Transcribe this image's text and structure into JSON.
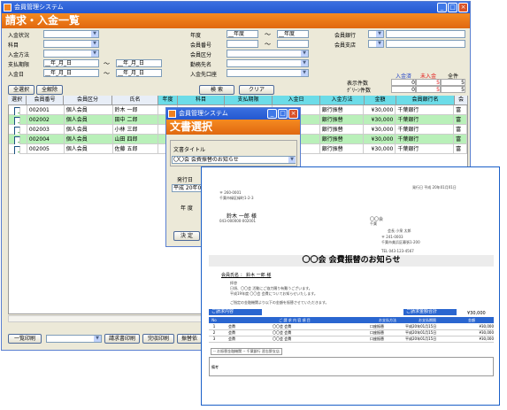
{
  "window": {
    "title": "会員管理システム",
    "header": "請求・入金一覧",
    "buttons": {
      "minimize": "_",
      "maximize": "□",
      "close": "×"
    }
  },
  "filters": {
    "payment_status": {
      "label": "入金状況",
      "value": ""
    },
    "subject": {
      "label": "科目",
      "value": ""
    },
    "payment_method": {
      "label": "入金方法",
      "value": ""
    },
    "due_date": {
      "label": "支払期限",
      "from": "__年_月_日",
      "to": "__年_月_日"
    },
    "payment_date": {
      "label": "入金日",
      "from": "__年_月_日",
      "to": "__年_月_日"
    },
    "year": {
      "label": "年度",
      "from": "__年度",
      "to": "__年度"
    },
    "member_no": {
      "label": "会員番号",
      "from": "",
      "to": ""
    },
    "member_type": {
      "label": "会員区分",
      "value": ""
    },
    "employer": {
      "label": "勤務先名",
      "value": ""
    },
    "payment_counter": {
      "label": "入金先口座",
      "value": ""
    },
    "member_bank": {
      "label": "会員銀行",
      "value": ""
    },
    "member_branch": {
      "label": "会員支店",
      "value": ""
    }
  },
  "actions": {
    "select_all": "全選択",
    "deselect_all": "全解除",
    "search": "検 索",
    "clear": "クリア"
  },
  "counts": {
    "headers": [
      "入金済",
      "未入金",
      "全件"
    ],
    "rows": [
      {
        "label": "表示件数",
        "values": [
          "0",
          "5",
          "5"
        ]
      },
      {
        "label": "ｸﾞﾘｰﾝ件数",
        "values": [
          "0",
          "5",
          "5"
        ]
      }
    ]
  },
  "table": {
    "columns": [
      "選択",
      "会員番号",
      "会員区分",
      "氏名",
      "年度",
      "科目",
      "支払期限",
      "入金日",
      "入金方法",
      "金額",
      "会員銀行名",
      "会"
    ],
    "rows": [
      {
        "member_no": "002001",
        "type": "個人会員",
        "name": "鈴木 一郎",
        "method": "銀行振替",
        "amount": "¥30,000",
        "bank": "千葉銀行",
        "extra": "富"
      },
      {
        "member_no": "002002",
        "type": "個人会員",
        "name": "田中 二郎",
        "method": "銀行振替",
        "amount": "¥30,000",
        "bank": "千葉銀行",
        "extra": "富"
      },
      {
        "member_no": "002003",
        "type": "個人会員",
        "name": "小林 三郎",
        "method": "銀行振替",
        "amount": "¥30,000",
        "bank": "千葉銀行",
        "extra": "富"
      },
      {
        "member_no": "002004",
        "type": "個人会員",
        "name": "山田 四郎",
        "method": "銀行振替",
        "amount": "¥30,000",
        "bank": "千葉銀行",
        "extra": "富"
      },
      {
        "member_no": "002005",
        "type": "個人会員",
        "name": "佐藤 五郎",
        "method": "銀行振替",
        "amount": "¥30,000",
        "bank": "千葉銀行",
        "extra": "富"
      }
    ]
  },
  "footer": {
    "list_print": "一覧印刷",
    "bill_print": "請求書印刷",
    "receipt_print": "完収印刷",
    "transfer_print": "振替依"
  },
  "dialog": {
    "title": "会員管理システム",
    "header": "文書選択",
    "doc_title_label": "文書タイトル",
    "doc_title_value": "〇〇会 会費振替のお知らせ",
    "issue_date_label": "発行日",
    "issue_date_value": "平成 20年07",
    "year_label": "年 度",
    "ok": "決 定"
  },
  "document": {
    "issue_date": "発行日 平成 20年01月01日",
    "postal": "〒 260-0001",
    "address": "千葉市緑区緑町1-2-3",
    "recipient": "鈴木 一郎 様",
    "recipient_tel": "043-000000-002001",
    "org_name": "〇〇会",
    "org_sub": "千葉",
    "org_rep": "会長   小泉 太郎",
    "org_postal": "〒 241-0003",
    "org_address": "千葉市美浜区幕張1-200",
    "org_tel": "TEL 043-123-4567",
    "title": "〇〇会 会費振替のお知らせ",
    "member_line": "会員氏名 ： 鈴木 一郎 様",
    "body1": "拝啓",
    "body2": "日頃、〇〇会 活動にご協力賜り有難うございます。",
    "body3": "平成19年度 〇〇会 会費についてお知らせいたします。",
    "body4": "ご指定の金融機関より以下の金額を振替させていただきます。",
    "bill_title": "ご請求内容",
    "bill_total_title": "ご請求金額合計",
    "bill_total_value": "¥30,000",
    "bill_cols": [
      "No",
      "ご 請 求 内 容 項 目",
      "お支払方法",
      "お支払期限",
      "金額"
    ],
    "bill_rows": [
      {
        "no": "1",
        "item": "会費",
        "desc": "〇〇会 会費",
        "method": "口座振替",
        "due": "平成20年01月15日",
        "amount": "¥30,000"
      },
      {
        "no": "2",
        "item": "会費",
        "desc": "〇〇会 会費",
        "method": "口座振替",
        "due": "平成20年01月15日",
        "amount": "¥30,000"
      },
      {
        "no": "3",
        "item": "会費",
        "desc": "〇〇会 会費",
        "method": "口座振替",
        "due": "平成20年01月15日",
        "amount": "¥30,000"
      }
    ],
    "bank_line": "-- お振替金融機関 --   千葉銀行   習志野支店",
    "remarks": "備考"
  },
  "colors": {
    "accent": "#f07818",
    "titlebar": "#2458d0",
    "row_green": "#b9f0b9",
    "header_hl": "#6cdce8"
  }
}
